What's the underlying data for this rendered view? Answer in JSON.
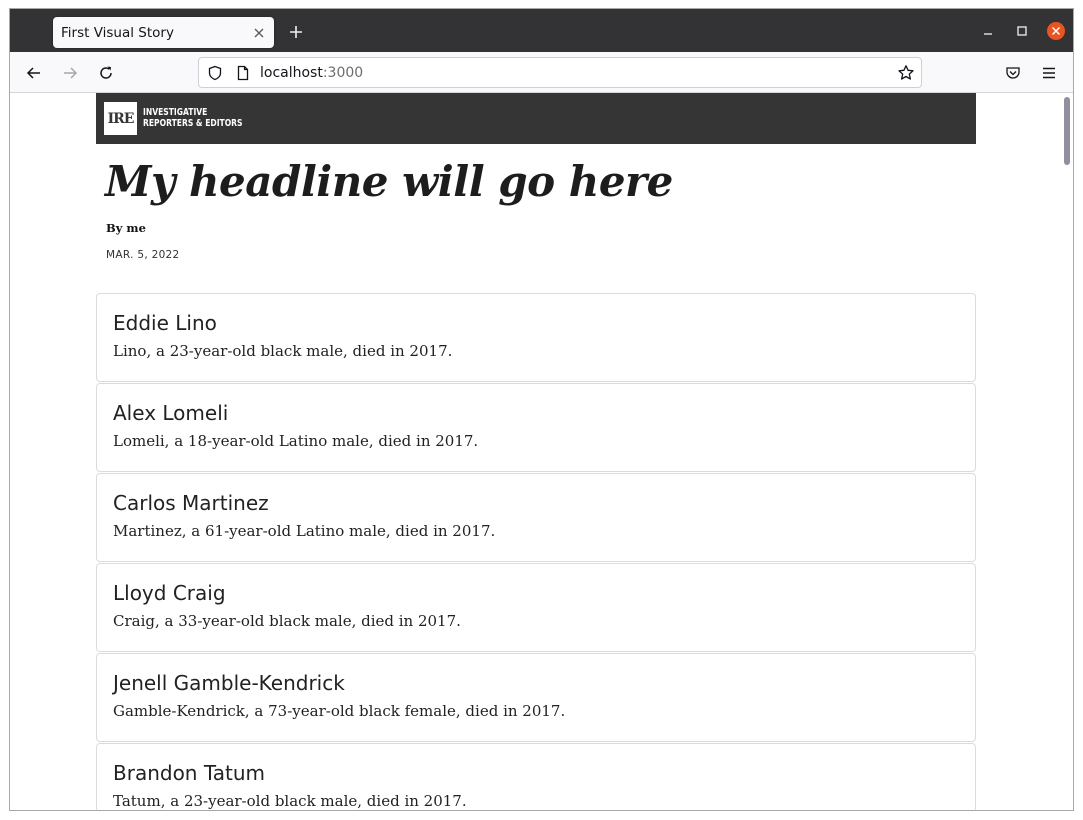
{
  "browser": {
    "tab_title": "First Visual Story",
    "url_host": "localhost",
    "url_port": ":3000"
  },
  "masthead": {
    "logo_text": "IRE",
    "org_line1": "INVESTIGATIVE",
    "org_line2": "REPORTERS & EDITORS"
  },
  "story": {
    "headline": "My headline will go here",
    "byline": "By me",
    "date": "MAR. 5, 2022"
  },
  "cards": [
    {
      "name": "Eddie Lino",
      "desc": "Lino, a 23-year-old black male, died in 2017."
    },
    {
      "name": "Alex Lomeli",
      "desc": "Lomeli, a 18-year-old Latino male, died in 2017."
    },
    {
      "name": "Carlos Martinez",
      "desc": "Martinez, a 61-year-old Latino male, died in 2017."
    },
    {
      "name": "Lloyd Craig",
      "desc": "Craig, a 33-year-old black male, died in 2017."
    },
    {
      "name": "Jenell Gamble-Kendrick",
      "desc": "Gamble-Kendrick, a 73-year-old black female, died in 2017."
    },
    {
      "name": "Brandon Tatum",
      "desc": "Tatum, a 23-year-old black male, died in 2017."
    }
  ],
  "icons": {
    "tab_close": "close-icon",
    "new_tab": "plus-icon",
    "minimize": "minimize-icon",
    "maximize": "maximize-icon",
    "close_window": "close-window-icon",
    "back": "back-arrow-icon",
    "forward": "forward-arrow-icon",
    "reload": "reload-icon",
    "shield": "shield-icon",
    "page": "page-icon",
    "bookmark": "star-icon",
    "pocket": "pocket-icon",
    "menu": "hamburger-menu-icon"
  },
  "colors": {
    "close_window": "#e95420",
    "masthead": "#353535"
  }
}
